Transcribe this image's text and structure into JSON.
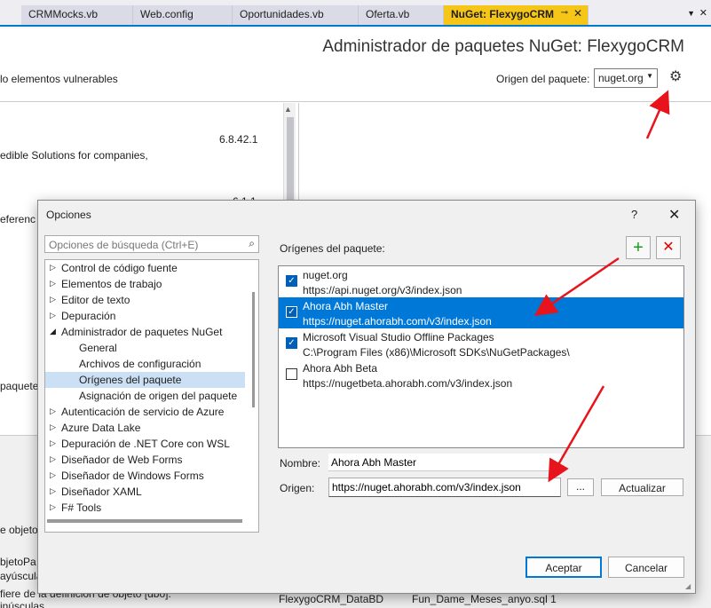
{
  "tabs": [
    {
      "label": "CRMMocks.vb"
    },
    {
      "label": "Web.config"
    },
    {
      "label": "Oportunidades.vb"
    },
    {
      "label": "Oferta.vb"
    },
    {
      "label": "NuGet: FlexygoCRM",
      "pin": "⊸",
      "close": "✕"
    }
  ],
  "nuget": {
    "title": "Administrador de paquetes NuGet: FlexygoCRM",
    "vulnerable_text": "lo elementos vulnerables",
    "source_label": "Origen del paquete:",
    "source_value": "nuget.org",
    "packages": [
      {
        "version": "6.8.42.1",
        "desc": "edible Solutions for companies,"
      },
      {
        "version": "6.1.1",
        "desc": "eferenc"
      }
    ],
    "paquetes_label": "paquetes"
  },
  "lower": {
    "lines": [
      "e objeto",
      "bjetoPa",
      "ayúscula",
      "fiere de la definición de objeto [dbo].",
      "inúsculas"
    ],
    "status_db": "FlexygoCRM_DataBD",
    "status_file": "Fun_Dame_Meses_anyo.sql",
    "status_line": "1"
  },
  "dialog": {
    "title": "Opciones",
    "help": "?",
    "close": "✕",
    "search_placeholder": "Opciones de búsqueda (Ctrl+E)",
    "tree": [
      {
        "label": "Control de código fuente",
        "level": 0
      },
      {
        "label": "Elementos de trabajo",
        "level": 0
      },
      {
        "label": "Editor de texto",
        "level": 0
      },
      {
        "label": "Depuración",
        "level": 0
      },
      {
        "label": "Administrador de paquetes NuGet",
        "level": 0,
        "expanded": true
      },
      {
        "label": "General",
        "level": 1
      },
      {
        "label": "Archivos de configuración",
        "level": 1
      },
      {
        "label": "Orígenes del paquete",
        "level": 1,
        "selected": true
      },
      {
        "label": "Asignación de origen del paquete",
        "level": 1
      },
      {
        "label": "Autenticación de servicio de Azure",
        "level": 0
      },
      {
        "label": "Azure Data Lake",
        "level": 0
      },
      {
        "label": "Depuración de .NET Core con WSL",
        "level": 0
      },
      {
        "label": "Diseñador de Web Forms",
        "level": 0
      },
      {
        "label": "Diseñador de Windows Forms",
        "level": 0
      },
      {
        "label": "Diseñador XAML",
        "level": 0
      },
      {
        "label": "F# Tools",
        "level": 0
      }
    ],
    "sources_label": "Orígenes del paquete:",
    "add_icon": "+",
    "remove_icon": "✕",
    "sources": [
      {
        "name": "nuget.org",
        "url": "https://api.nuget.org/v3/index.json",
        "checked": true
      },
      {
        "name": "Ahora Abh Master",
        "url": "https://nuget.ahorabh.com/v3/index.json",
        "checked": true,
        "selected": true
      },
      {
        "name": "Microsoft Visual Studio Offline Packages",
        "url": "C:\\Program Files (x86)\\Microsoft SDKs\\NuGetPackages\\",
        "checked": true
      },
      {
        "name": "Ahora Abh Beta",
        "url": "https://nugetbeta.ahorabh.com/v3/index.json",
        "checked": false
      }
    ],
    "name_label": "Nombre:",
    "name_value": "Ahora Abh Master",
    "origin_label": "Origen:",
    "origin_value": "https://nuget.ahorabh.com/v3/index.json",
    "browse_label": "...",
    "update_label": "Actualizar",
    "ok_label": "Aceptar",
    "cancel_label": "Cancelar"
  },
  "colors": {
    "accent": "#0078d7",
    "active_tab": "#f5c518",
    "annotation": "#e8141b"
  }
}
